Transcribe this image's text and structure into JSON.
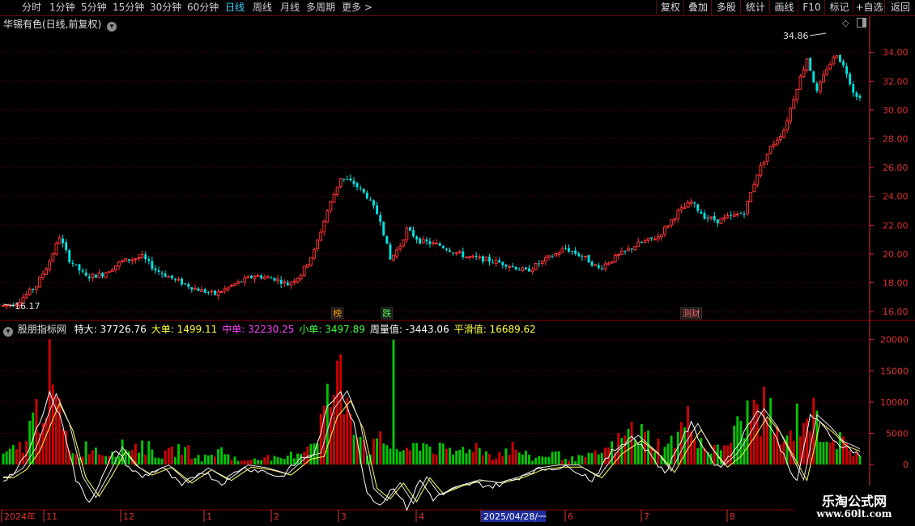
{
  "toolbar": {
    "periods": [
      "分时",
      "1分钟",
      "5分钟",
      "15分钟",
      "30分钟",
      "60分钟",
      "日线",
      "周线",
      "月线",
      "多周期",
      "更多 >"
    ],
    "active_period": "日线",
    "right_buttons": [
      "复权",
      "叠加",
      "多股",
      "统计",
      "画线",
      "F10",
      "标记",
      "+自选",
      "返回"
    ]
  },
  "main_panel": {
    "title": "华锡有色(日线,前复权)",
    "price_high_label": "34.86",
    "price_low_label": "16.17",
    "markers": [
      {
        "label": "榜",
        "color": "#ff9c00",
        "date_index": 101
      },
      {
        "label": "跌",
        "color": "#4cff4c",
        "date_index": 116
      },
      {
        "label": "测财",
        "color": "#ff6666",
        "date_index": 208
      }
    ]
  },
  "indicator_panel": {
    "name": "股朋指标网",
    "values": [
      {
        "label": "特大:",
        "value": "37726.76",
        "color": "#ffffff"
      },
      {
        "label": "大单:",
        "value": "1499.11",
        "color": "#ffff40"
      },
      {
        "label": "中单:",
        "value": "32230.25",
        "color": "#ff40ff"
      },
      {
        "label": "小单:",
        "value": "3497.89",
        "color": "#40ff40"
      },
      {
        "label": "周量值:",
        "value": "-3443.06",
        "color": "#ffffff"
      },
      {
        "label": "平滑值:",
        "value": "16689.62",
        "color": "#ffff40"
      }
    ]
  },
  "time_axis": {
    "labels": [
      "2024年",
      "11",
      "12",
      "1",
      "2",
      "3",
      "4",
      "2025/04/28/一",
      "6",
      "7",
      "8"
    ],
    "cursor_label": "2025/04/28/一"
  },
  "watermark": {
    "line1": "乐淘公式网",
    "line2": "www.60lt.com"
  },
  "colors": {
    "up": "#ff3232",
    "down": "#00e6e6",
    "bar_pos": "#d40000",
    "bar_neg": "#00c800",
    "grid": "#7a0000",
    "axis": "#e03030"
  },
  "chart_data": {
    "type": "candlestick+bar",
    "price_axis": {
      "ylim": [
        15.5,
        35.5
      ],
      "ticks": [
        "16.00",
        "18.00",
        "20.00",
        "22.00",
        "24.00",
        "26.00",
        "28.00",
        "30.00",
        "32.00",
        "34.00"
      ]
    },
    "indicator_axis": {
      "ylim": [
        -7000,
        21000
      ],
      "ticks": [
        "0",
        "5000",
        "10000",
        "15000",
        "20000"
      ]
    },
    "price_anchors": [
      [
        0,
        16.4
      ],
      [
        4,
        16.6
      ],
      [
        10,
        17.8
      ],
      [
        14,
        19.5
      ],
      [
        17,
        21.2
      ],
      [
        20,
        19.6
      ],
      [
        25,
        18.4
      ],
      [
        30,
        18.6
      ],
      [
        36,
        19.5
      ],
      [
        42,
        19.8
      ],
      [
        46,
        18.9
      ],
      [
        52,
        18.2
      ],
      [
        58,
        17.6
      ],
      [
        64,
        17.2
      ],
      [
        70,
        17.9
      ],
      [
        76,
        18.5
      ],
      [
        82,
        18.3
      ],
      [
        86,
        17.9
      ],
      [
        90,
        18.6
      ],
      [
        94,
        20.2
      ],
      [
        98,
        23.0
      ],
      [
        102,
        25.3
      ],
      [
        106,
        24.9
      ],
      [
        110,
        24.0
      ],
      [
        114,
        22.4
      ],
      [
        117,
        19.6
      ],
      [
        120,
        20.6
      ],
      [
        122,
        21.7
      ],
      [
        126,
        20.9
      ],
      [
        132,
        20.6
      ],
      [
        140,
        19.8
      ],
      [
        146,
        19.6
      ],
      [
        152,
        19.3
      ],
      [
        158,
        18.8
      ],
      [
        164,
        19.6
      ],
      [
        170,
        20.4
      ],
      [
        176,
        19.7
      ],
      [
        180,
        19.0
      ],
      [
        186,
        19.9
      ],
      [
        192,
        20.7
      ],
      [
        198,
        21.2
      ],
      [
        204,
        22.9
      ],
      [
        208,
        23.6
      ],
      [
        212,
        22.6
      ],
      [
        216,
        22.3
      ],
      [
        220,
        22.6
      ],
      [
        224,
        22.9
      ],
      [
        228,
        25.6
      ],
      [
        232,
        27.4
      ],
      [
        236,
        28.6
      ],
      [
        240,
        31.6
      ],
      [
        243,
        33.6
      ],
      [
        246,
        31.2
      ],
      [
        249,
        32.9
      ],
      [
        252,
        33.9
      ],
      [
        255,
        32.6
      ],
      [
        257,
        31.3
      ],
      [
        259,
        30.8
      ]
    ],
    "indicator_anchors": [
      [
        0,
        1500
      ],
      [
        6,
        3500
      ],
      [
        10,
        9000
      ],
      [
        14,
        15000
      ],
      [
        18,
        6000
      ],
      [
        22,
        1500
      ],
      [
        26,
        3500
      ],
      [
        30,
        2000
      ],
      [
        36,
        3000
      ],
      [
        42,
        3500
      ],
      [
        48,
        1500
      ],
      [
        54,
        3000
      ],
      [
        60,
        1000
      ],
      [
        66,
        2500
      ],
      [
        72,
        500
      ],
      [
        78,
        1500
      ],
      [
        84,
        800
      ],
      [
        90,
        2500
      ],
      [
        94,
        4500
      ],
      [
        98,
        11000
      ],
      [
        102,
        15000
      ],
      [
        106,
        9000
      ],
      [
        110,
        2500
      ],
      [
        114,
        4000
      ],
      [
        118,
        3500
      ],
      [
        122,
        2000
      ],
      [
        126,
        4000
      ],
      [
        130,
        3000
      ],
      [
        136,
        2000
      ],
      [
        142,
        3500
      ],
      [
        148,
        1500
      ],
      [
        154,
        3000
      ],
      [
        160,
        1000
      ],
      [
        166,
        2000
      ],
      [
        172,
        1000
      ],
      [
        178,
        1500
      ],
      [
        184,
        3000
      ],
      [
        190,
        6000
      ],
      [
        196,
        4500
      ],
      [
        200,
        2500
      ],
      [
        204,
        5500
      ],
      [
        208,
        8000
      ],
      [
        212,
        3000
      ],
      [
        216,
        2500
      ],
      [
        220,
        4500
      ],
      [
        224,
        8000
      ],
      [
        228,
        10000
      ],
      [
        232,
        8500
      ],
      [
        236,
        3000
      ],
      [
        240,
        8000
      ],
      [
        244,
        9000
      ],
      [
        248,
        6000
      ],
      [
        252,
        4500
      ],
      [
        256,
        2500
      ],
      [
        259,
        2000
      ]
    ],
    "line_anchors": [
      [
        0,
        -2500
      ],
      [
        4,
        -1000
      ],
      [
        8,
        2500
      ],
      [
        14,
        11500
      ],
      [
        18,
        6500
      ],
      [
        22,
        -2500
      ],
      [
        26,
        -6000
      ],
      [
        30,
        -2000
      ],
      [
        34,
        2500
      ],
      [
        38,
        -500
      ],
      [
        42,
        -2000
      ],
      [
        48,
        -500
      ],
      [
        54,
        -3500
      ],
      [
        60,
        -1000
      ],
      [
        66,
        -3000
      ],
      [
        72,
        -500
      ],
      [
        78,
        -1000
      ],
      [
        84,
        -2000
      ],
      [
        90,
        1000
      ],
      [
        94,
        1500
      ],
      [
        98,
        9000
      ],
      [
        102,
        12000
      ],
      [
        106,
        6500
      ],
      [
        110,
        -4500
      ],
      [
        114,
        -6500
      ],
      [
        118,
        -3500
      ],
      [
        122,
        -7000
      ],
      [
        126,
        -2500
      ],
      [
        130,
        -5500
      ],
      [
        136,
        -4000
      ],
      [
        142,
        -3000
      ],
      [
        148,
        -3500
      ],
      [
        154,
        -2500
      ],
      [
        160,
        -1000
      ],
      [
        166,
        -500
      ],
      [
        172,
        -500
      ],
      [
        178,
        -2500
      ],
      [
        184,
        2000
      ],
      [
        190,
        4500
      ],
      [
        196,
        1500
      ],
      [
        200,
        -1500
      ],
      [
        204,
        3000
      ],
      [
        208,
        6500
      ],
      [
        212,
        2500
      ],
      [
        216,
        -500
      ],
      [
        220,
        1500
      ],
      [
        224,
        5000
      ],
      [
        228,
        9000
      ],
      [
        232,
        6000
      ],
      [
        236,
        1500
      ],
      [
        240,
        -3000
      ],
      [
        244,
        8000
      ],
      [
        248,
        6000
      ],
      [
        252,
        3500
      ],
      [
        256,
        2500
      ],
      [
        259,
        1500
      ]
    ],
    "n_bars": 260
  }
}
